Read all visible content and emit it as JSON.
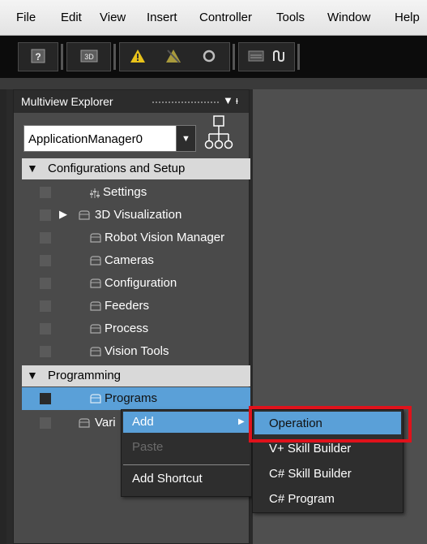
{
  "menubar": {
    "items": [
      "File",
      "Edit",
      "View",
      "Insert",
      "Controller",
      "Tools",
      "Window",
      "Help"
    ]
  },
  "toolbar": {
    "icons": [
      "help-icon",
      "3d-icon",
      "warning-icon",
      "warning-off-icon",
      "refresh-icon",
      "signal-icon",
      "route-icon"
    ],
    "help_label": "?",
    "threed_label": "3D"
  },
  "explorer": {
    "title": "Multiview Explorer",
    "combo_value": "ApplicationManager0",
    "sections": [
      {
        "label": "Configurations and Setup",
        "items": [
          "Settings",
          "3D Visualization",
          "Robot Vision Manager",
          "Cameras",
          "Configuration",
          "Feeders",
          "Process",
          "Vision Tools"
        ]
      },
      {
        "label": "Programming",
        "items": [
          "Programs",
          "Vari"
        ]
      }
    ]
  },
  "context_menu": {
    "items": [
      "Add",
      "Paste",
      "Add Shortcut"
    ]
  },
  "submenu": {
    "items": [
      "Operation",
      "V+ Skill Builder",
      "C# Skill Builder",
      "C# Program"
    ]
  },
  "colors": {
    "highlight": "#5aa0d8",
    "annotation_red": "#e0121b"
  }
}
